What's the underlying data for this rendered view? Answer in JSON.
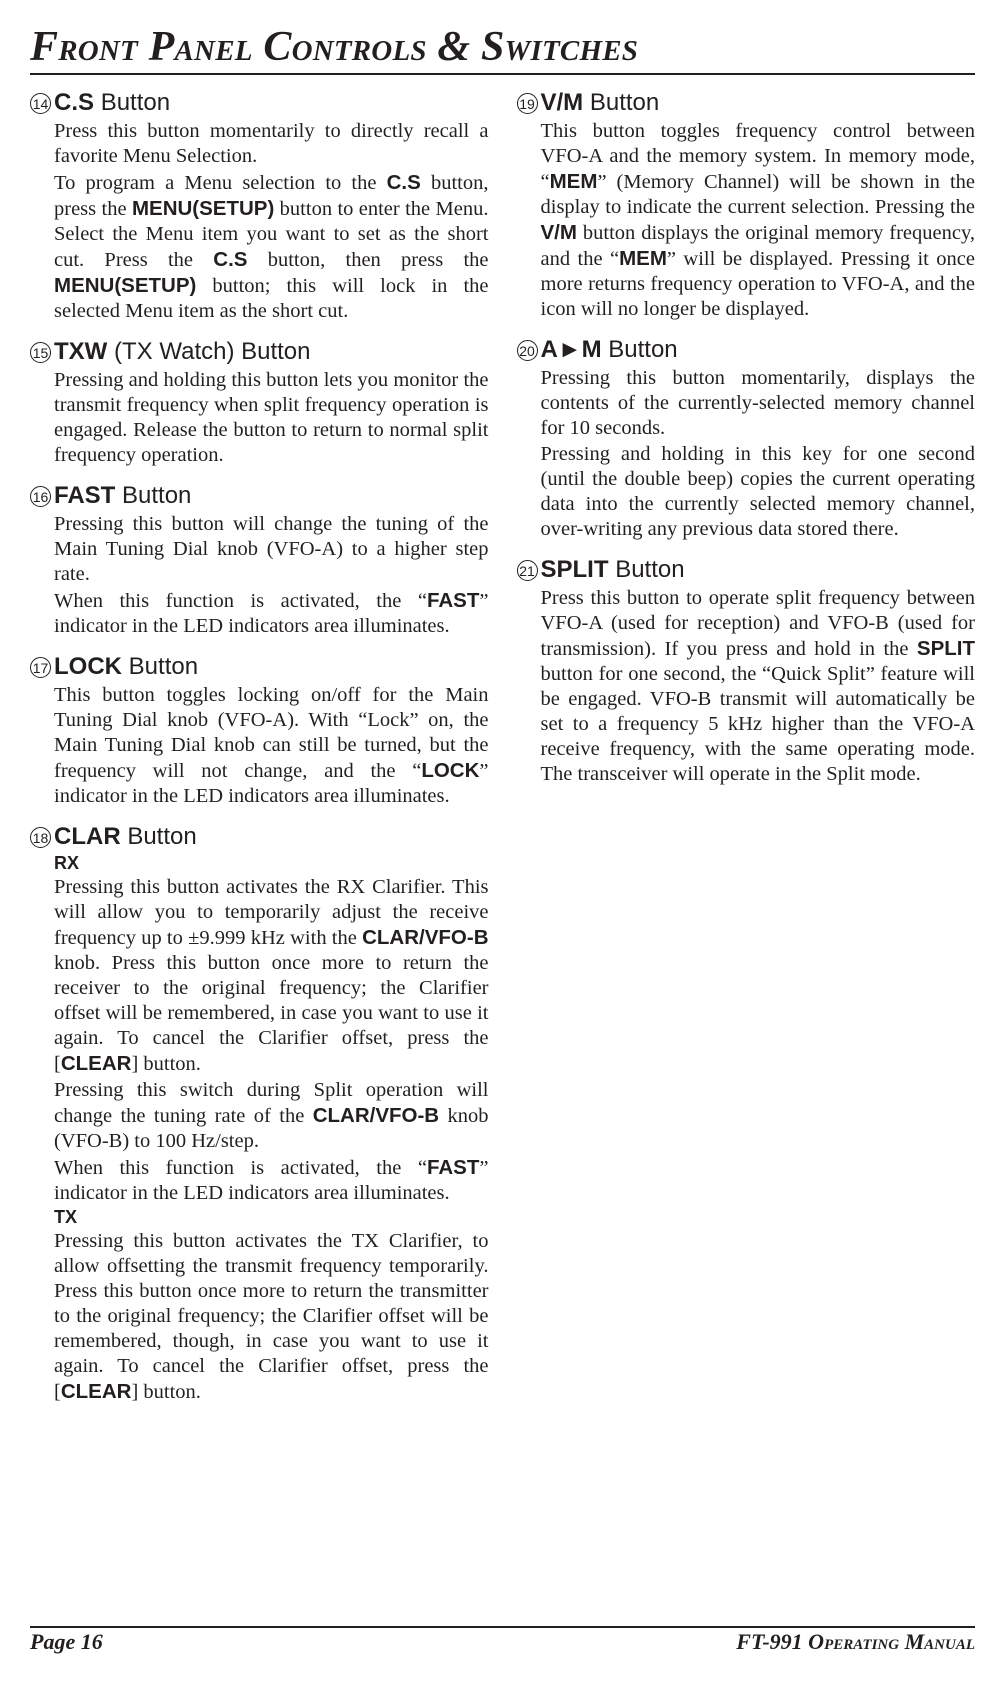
{
  "title": "Front Panel Controls & Switches",
  "left": [
    {
      "num": "14",
      "title_html": "<span class='b'>C.S</span> <span class='thin'>Button</span>",
      "paras": [
        "Press this button momentarily to directly recall a favorite Menu Selection.",
        "To program a Menu selection to the <span class='b'>C.S</span> button, press the <span class='b'>MENU(SETUP)</span> button to enter the Menu. Select the Menu item you want to set as the short cut. Press the <span class='b'>C.S</span> button, then press the <span class='b'>MENU(SETUP)</span> button; this will lock in the selected Menu item as the short cut."
      ]
    },
    {
      "num": "15",
      "title_html": "<span class='b'>TXW</span> <span class='thin'>(TX Watch) Button</span>",
      "paras": [
        "Pressing and holding this button lets you monitor the transmit frequency when split frequency operation is engaged. Release the button to return to normal split frequency operation."
      ]
    },
    {
      "num": "16",
      "title_html": "<span class='b'>FAST</span> <span class='thin'>Button</span>",
      "paras": [
        "Pressing this button will change the tuning of the Main Tuning Dial knob (VFO-A) to a higher step rate.",
        "When this function is activated, the “<span class='b'>FAST</span>” indicator in the LED indicators area illuminates."
      ]
    },
    {
      "num": "17",
      "title_html": "<span class='b'>LOCK</span> <span class='thin'>Button</span>",
      "paras": [
        "This button toggles locking on/off for the Main Tuning Dial knob (VFO-A). With “Lock” on, the Main Tuning Dial knob can still be turned, but the frequency will not change, and the “<span class='b'>LOCK</span>” indicator in the LED indicators area illuminates."
      ]
    },
    {
      "num": "18",
      "title_html": "<span class='b'>CLAR</span> <span class='thin'>Button</span>",
      "subs": [
        {
          "label": "RX",
          "paras": [
            "Pressing this button activates the RX Clarifier. This will allow you to temporarily adjust the receive frequency up to ±9.999 kHz with the <span class='b'>CLAR/VFO-B</span> knob. Press this button once more to return the receiver to the original frequency; the Clarifier offset will be remembered, in case you want to use it again. To cancel the Clarifier offset, press the [<span class='b'>CLEAR</span>] button.",
            "Pressing this switch during Split operation will change the tuning rate of the <span class='b'>CLAR/VFO-B</span> knob (VFO-B) to 100 Hz/step.",
            "When this function is activated, the “<span class='b'>FAST</span>” indicator in the LED indicators area illuminates."
          ]
        },
        {
          "label": "TX",
          "paras": [
            "Pressing this button activates the TX Clarifier, to allow offsetting the transmit frequency temporarily. Press this button once more to return the transmitter to the original frequency; the Clarifier offset will be remembered, though, in case you want to use it again. To cancel the Clarifier offset, press the [<span class='b'>CLEAR</span>] button."
          ]
        }
      ]
    }
  ],
  "right": [
    {
      "num": "19",
      "title_html": "<span class='b'>V/M</span> <span class='thin'>Button</span>",
      "paras": [
        "This button toggles frequency control between VFO-A and the memory system. In memory mode, “<span class='b'>MEM</span>” (Memory Channel) will be shown in the display to indicate the current selection. Pressing the <span class='b'>V/M</span> button displays the original memory frequency, and the “<span class='b'>MEM</span>” will be displayed. Pressing it once more returns frequency operation to VFO-A, and the icon will no longer be displayed."
      ]
    },
    {
      "num": "20",
      "title_html": "<span class='b'>A►M</span> <span class='thin'>Button</span>",
      "paras": [
        "Pressing this button momentarily, displays the contents of the currently-selected memory channel for 10 seconds.",
        "Pressing and holding in this key for one second (until the double beep) copies the current operating data into the currently selected memory channel, over-writing any previous data stored there."
      ]
    },
    {
      "num": "21",
      "title_html": "<span class='b'>SPLIT</span> <span class='thin'>Button</span>",
      "paras": [
        "Press this button to operate split frequency between VFO-A (used for reception) and VFO-B (used for transmission). If you press and hold in the <span class='b'>SPLIT</span> button for one second, the “Quick Split” feature will be engaged. VFO-B transmit will automatically be set to a frequency 5 kHz higher than the VFO-A receive frequency, with the same operating mode. The transceiver will operate in the Split mode."
      ]
    }
  ],
  "footer": {
    "left": "Page 16",
    "right": "FT-991 Operating Manual"
  }
}
